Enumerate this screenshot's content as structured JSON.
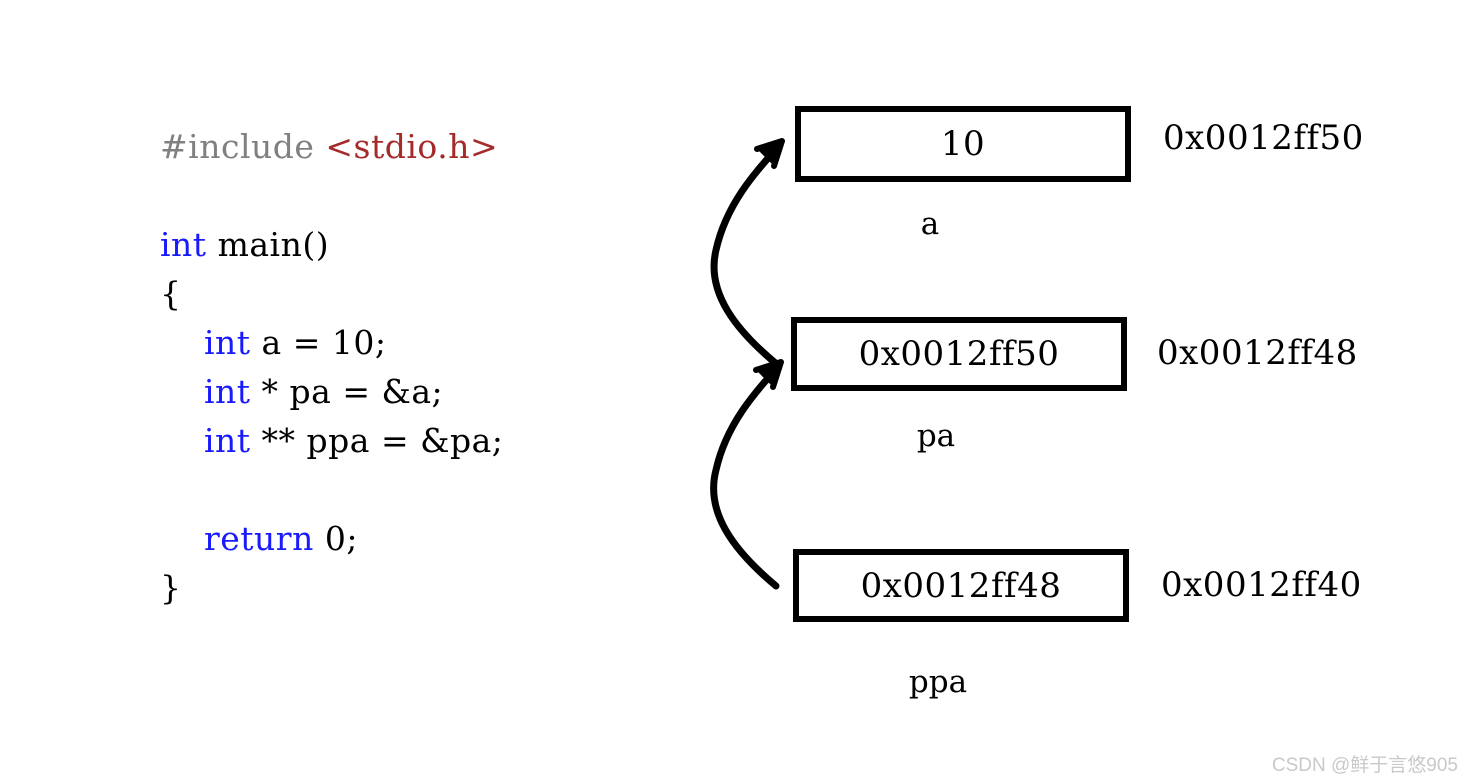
{
  "code": {
    "lines": [
      [
        {
          "t": "#include ",
          "c": "pre"
        },
        {
          "t": "<stdio.h>",
          "c": "hdr"
        }
      ],
      [],
      [
        {
          "t": "int",
          "c": "kw"
        },
        {
          "t": " main()",
          "c": "plain"
        }
      ],
      [
        {
          "t": "{",
          "c": "plain"
        }
      ],
      [
        {
          "t": "    ",
          "c": "plain"
        },
        {
          "t": "int",
          "c": "kw"
        },
        {
          "t": " a = 10;",
          "c": "plain"
        }
      ],
      [
        {
          "t": "    ",
          "c": "plain"
        },
        {
          "t": "int",
          "c": "kw"
        },
        {
          "t": " * pa = &a;",
          "c": "plain"
        }
      ],
      [
        {
          "t": "    ",
          "c": "plain"
        },
        {
          "t": "int",
          "c": "kw"
        },
        {
          "t": " ** ppa = &pa;",
          "c": "plain"
        }
      ],
      [],
      [
        {
          "t": "    ",
          "c": "plain"
        },
        {
          "t": "return",
          "c": "kw"
        },
        {
          "t": " 0;",
          "c": "plain"
        }
      ],
      [
        {
          "t": "}",
          "c": "plain"
        }
      ]
    ],
    "colors": {
      "preprocessor": "#808080",
      "header": "#a52a2a",
      "keyword": "#1a1aff",
      "plain": "#000000"
    }
  },
  "memory": {
    "cells": [
      {
        "value": "10",
        "address": "0x0012ff50",
        "label": "a"
      },
      {
        "value": "0x0012ff50",
        "address": "0x0012ff48",
        "label": "pa"
      },
      {
        "value": "0x0012ff48",
        "address": "0x0012ff40",
        "label": "ppa"
      }
    ]
  },
  "arrows": [
    {
      "name": "pa-points-to-a",
      "from": "pa-cell",
      "to": "a-cell"
    },
    {
      "name": "ppa-points-to-pa",
      "from": "ppa-cell",
      "to": "pa-cell"
    }
  ],
  "watermark": {
    "text": "CSDN @鲜于言悠905",
    "color": "#c9c9c9"
  }
}
